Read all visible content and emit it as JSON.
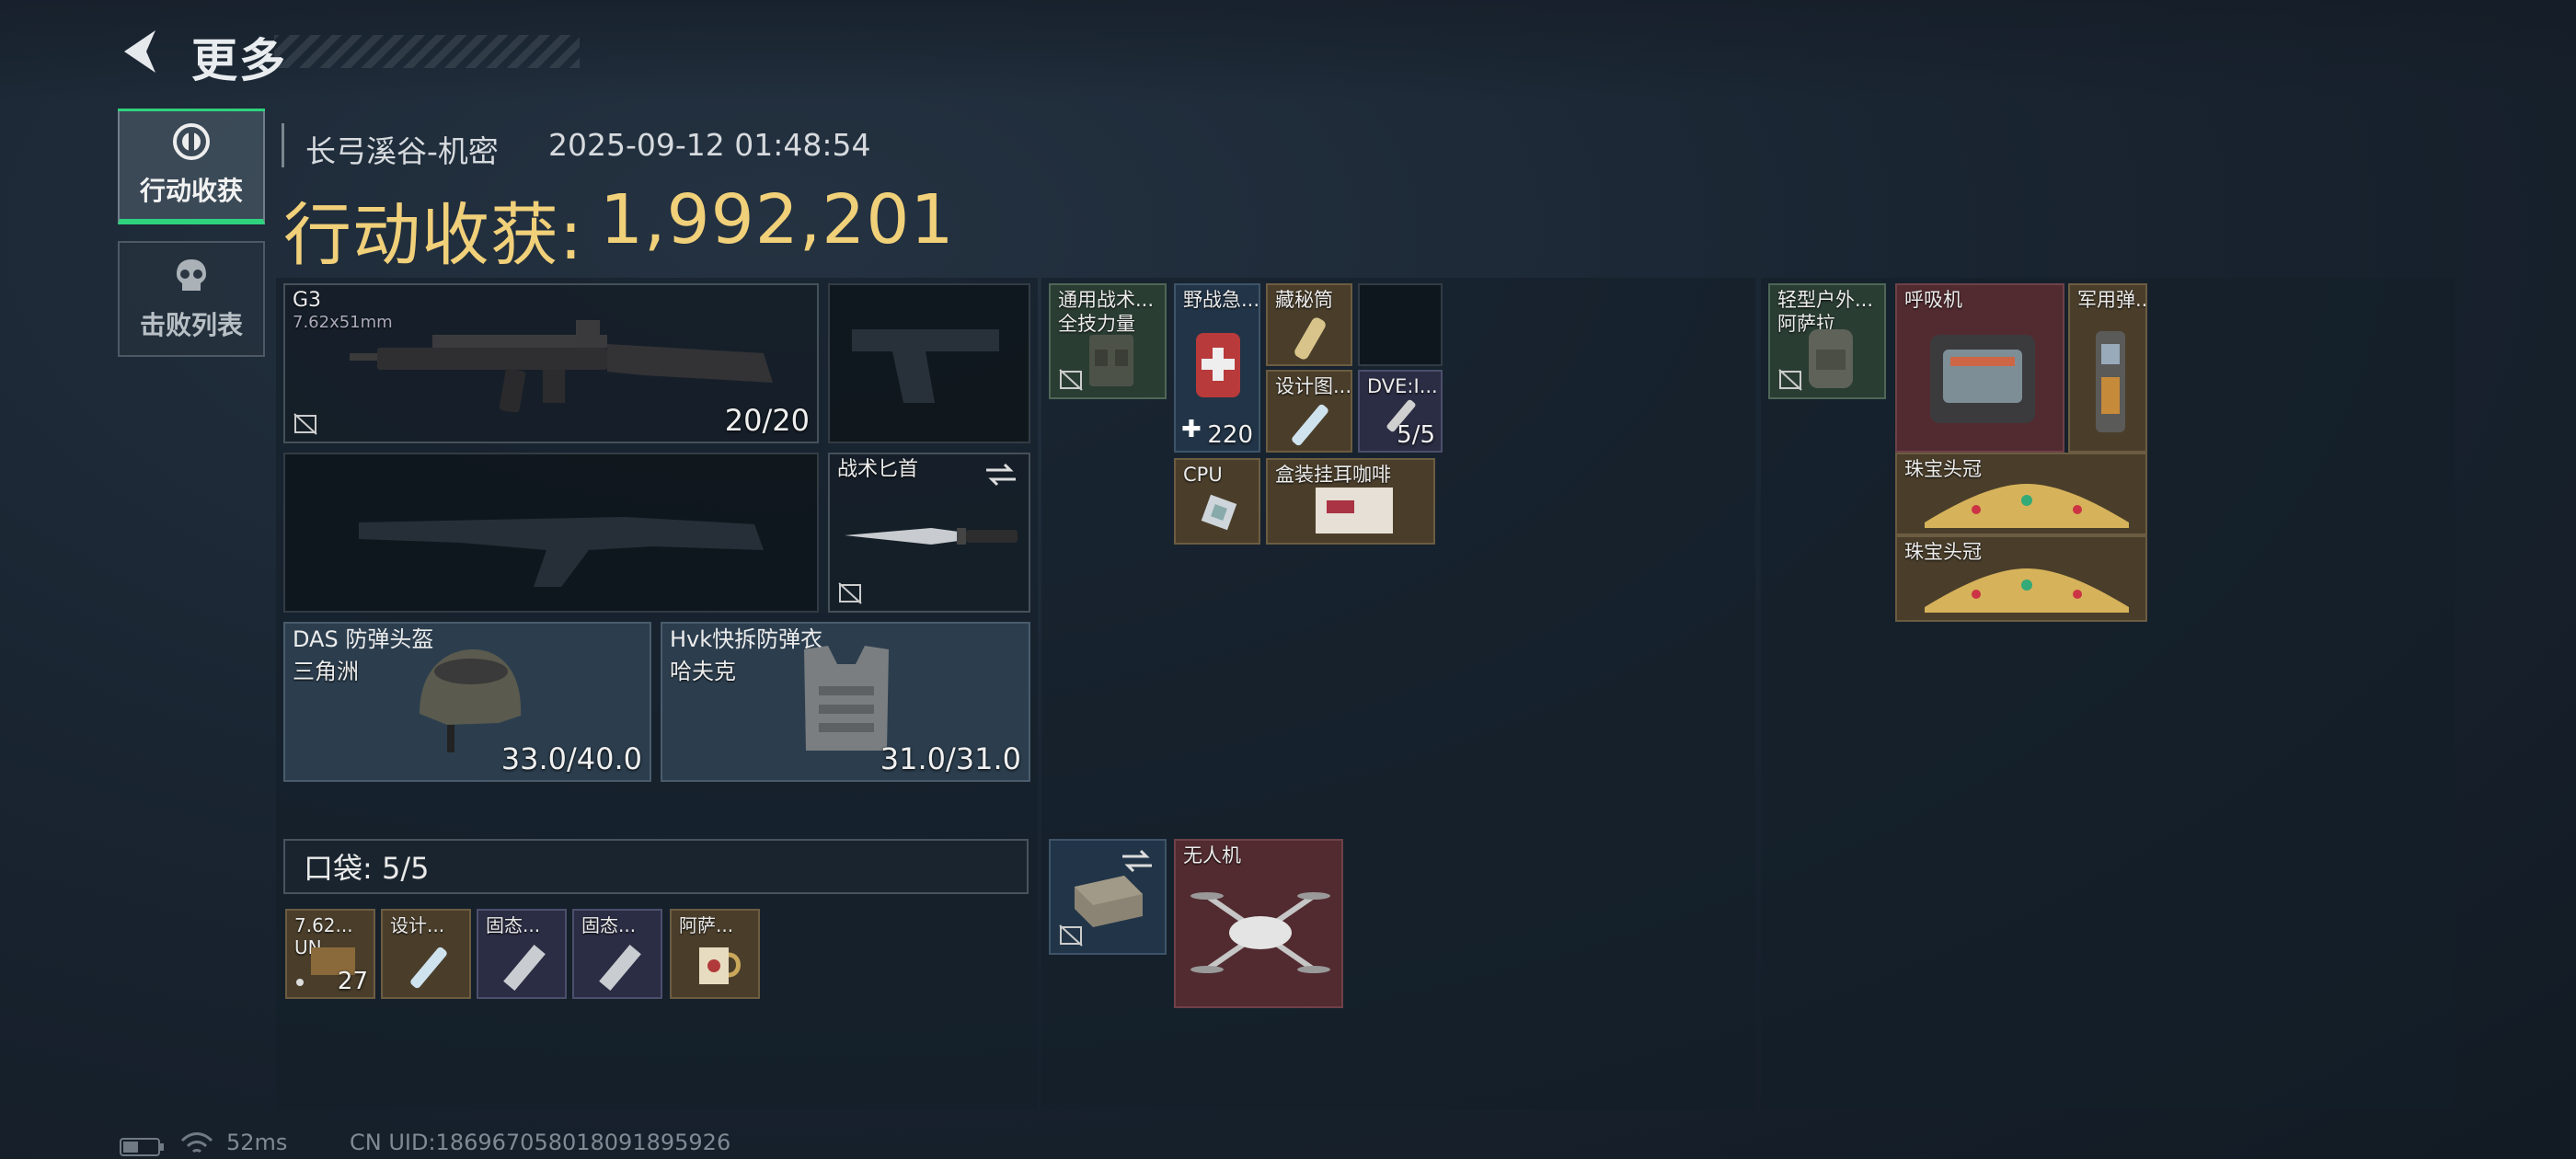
{
  "header": {
    "title": "更多"
  },
  "tabs": [
    {
      "label": "行动收获",
      "icon": "loot-target-icon",
      "active": true
    },
    {
      "label": "击败列表",
      "icon": "skull-icon",
      "active": false
    }
  ],
  "info": {
    "map": "长弓溪谷-机密",
    "datetime": "2025-09-12 01:48:54",
    "value_label": "行动收获:",
    "value": "1,992,201"
  },
  "loadout": {
    "primary": {
      "name": "G3",
      "caliber": "7.62x51mm",
      "ammo": "20/20"
    },
    "knife": {
      "name": "战术匕首"
    },
    "helmet": {
      "name": "DAS 防弹头盔",
      "faction": "三角洲",
      "durability": "33.0/40.0"
    },
    "armor": {
      "name": "Hvk快拆防弹衣",
      "faction": "哈夫克",
      "durability": "31.0/31.0"
    }
  },
  "pockets": {
    "label": "口袋: 5/5",
    "items": [
      {
        "name": "7.62...",
        "sub": "UN...",
        "count": "27"
      },
      {
        "name": "设计..."
      },
      {
        "name": "固态..."
      },
      {
        "name": "固态..."
      },
      {
        "name": "阿萨..."
      }
    ]
  },
  "chest_rig": {
    "container": {
      "name": "通用战术...",
      "sub": "全技力量"
    },
    "items": [
      {
        "name": "野战急...",
        "count": "220"
      },
      {
        "name": "藏秘筒"
      },
      {
        "name": "设计图..."
      },
      {
        "name": "DVE:I...",
        "count": "5/5"
      },
      {
        "name": "CPU"
      },
      {
        "name": "盒装挂耳咖啡"
      }
    ]
  },
  "secure": {
    "items": [
      {
        "name": "无人机"
      }
    ]
  },
  "backpack": {
    "container": {
      "name": "轻型户外...",
      "sub": "阿萨拉"
    },
    "items": [
      {
        "name": "呼吸机"
      },
      {
        "name": "军用弹..."
      },
      {
        "name": "珠宝头冠"
      },
      {
        "name": "珠宝头冠"
      }
    ]
  },
  "status": {
    "ping": "52ms",
    "uid": "CN UID:186967058018091895926"
  },
  "colors": {
    "value_gold": "#f1d07a",
    "active_green": "#2fd27d"
  }
}
